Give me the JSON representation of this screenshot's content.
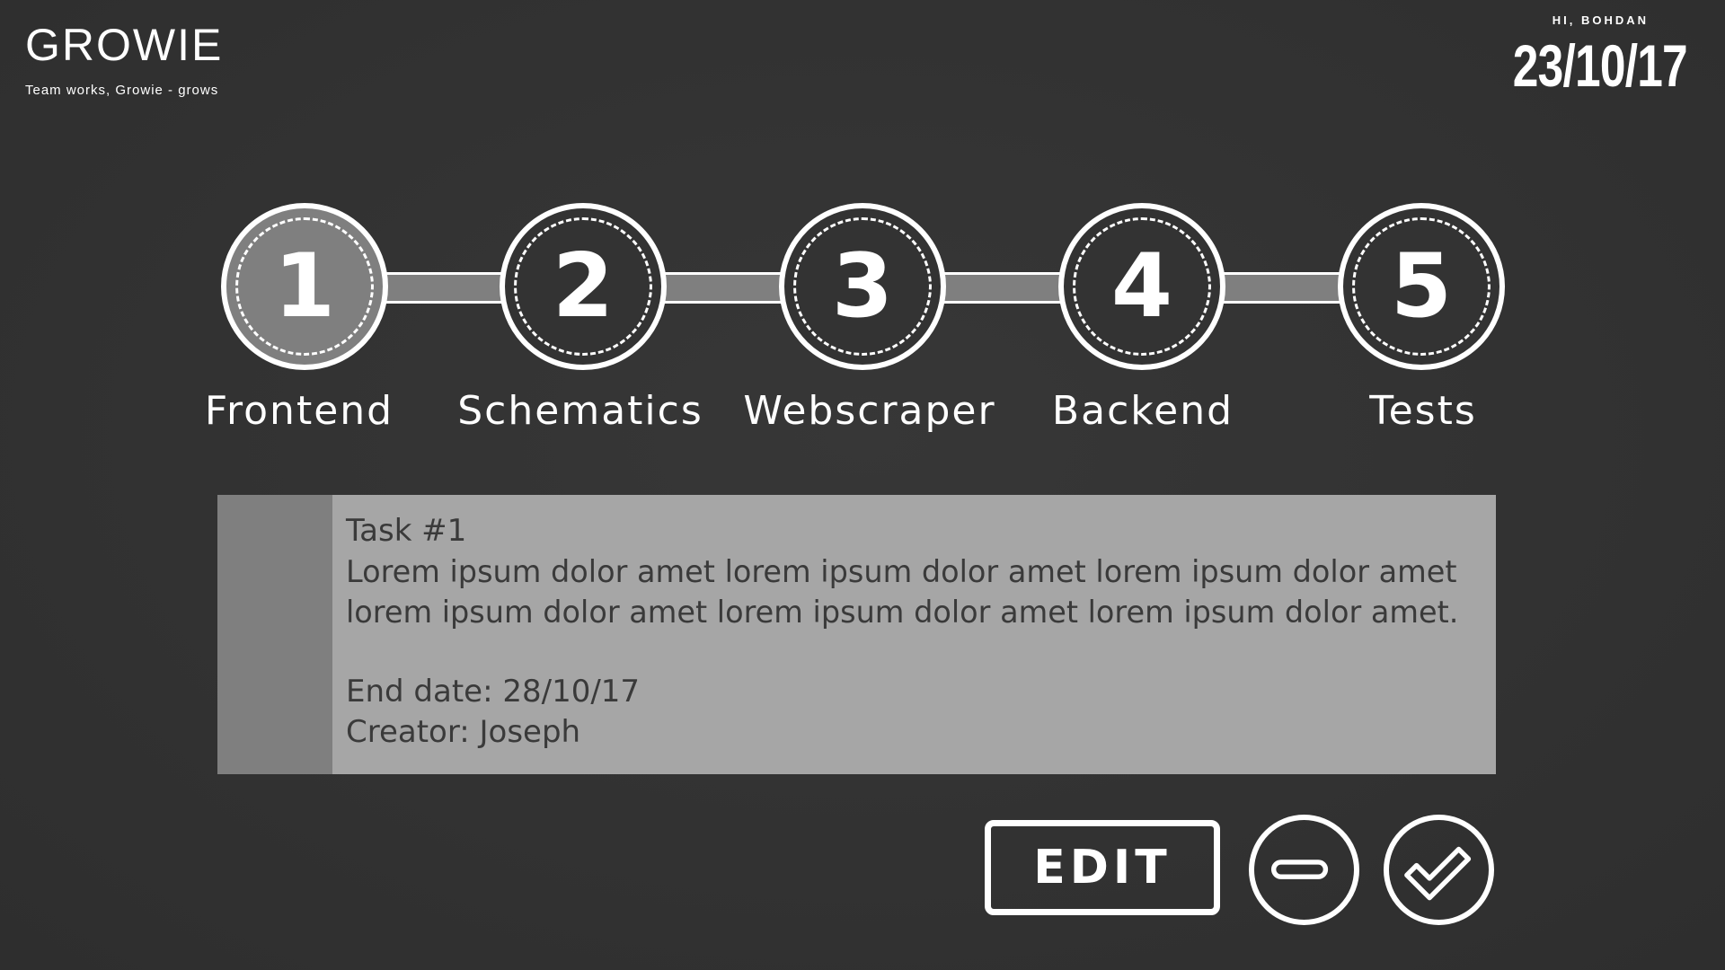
{
  "header": {
    "app_title": "GROWIE",
    "tagline": "Team works, Growie - grows",
    "greeting": "HI, BOHDAN",
    "date": "23/10/17"
  },
  "steps": [
    {
      "number": "1",
      "label": "Frontend",
      "active": true
    },
    {
      "number": "2",
      "label": "Schematics",
      "active": false
    },
    {
      "number": "3",
      "label": "Webscraper",
      "active": false
    },
    {
      "number": "4",
      "label": "Backend",
      "active": false
    },
    {
      "number": "5",
      "label": "Tests",
      "active": false
    }
  ],
  "task": {
    "title": "Task #1",
    "description_line1": "Lorem ipsum dolor amet lorem ipsum dolor amet lorem ipsum dolor amet",
    "description_line2": "lorem ipsum dolor amet lorem ipsum dolor amet lorem ipsum dolor amet.",
    "end_date": "End date: 28/10/17",
    "creator": "Creator: Joseph"
  },
  "actions": {
    "edit_label": "EDIT",
    "remove_icon": "minus-icon",
    "complete_icon": "check-icon"
  },
  "colors": {
    "background": "#333333",
    "accent_gray": "#7f7f7f",
    "card_gray": "#a6a6a6",
    "foreground": "#ffffff"
  }
}
